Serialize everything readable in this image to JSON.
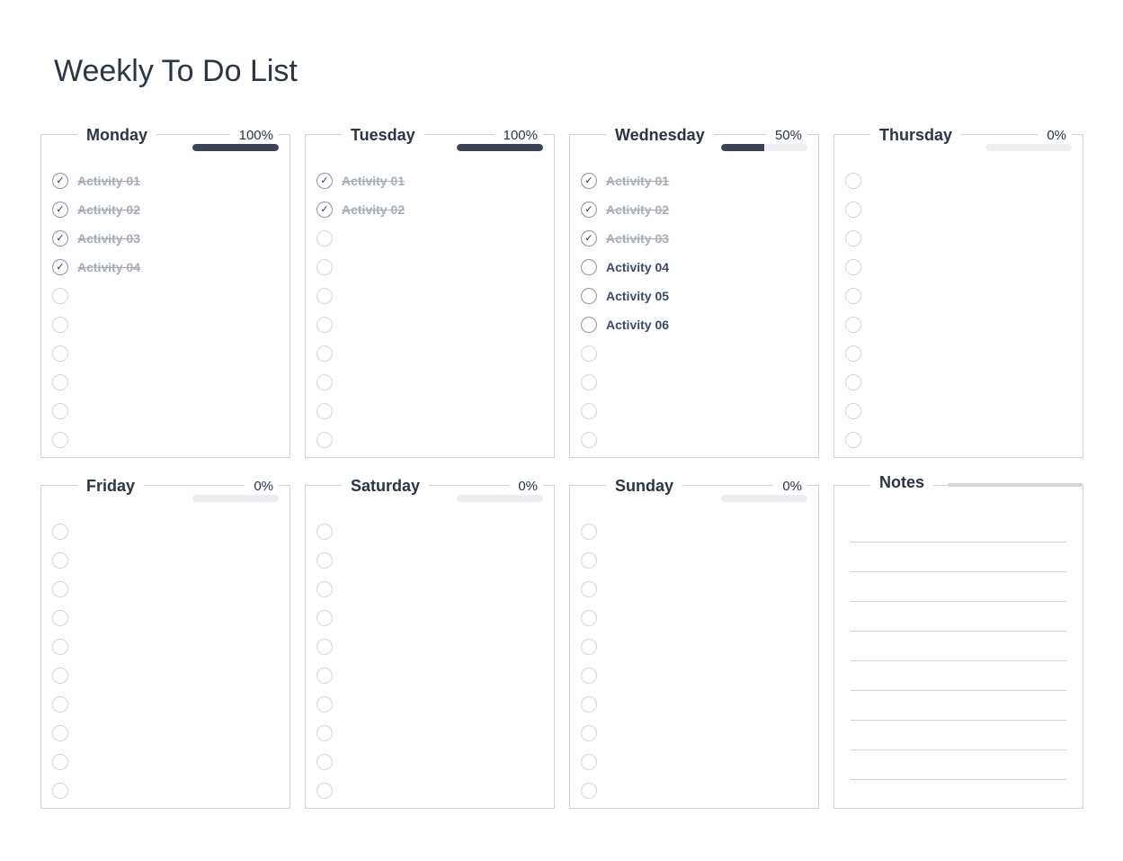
{
  "title": "Weekly To Do List",
  "notes_label": "Notes",
  "note_line_count": 9,
  "empty_rows_per_card": 10,
  "days": [
    {
      "name": "Monday",
      "percent": "100%",
      "progress": 100,
      "items": [
        {
          "label": "Activity 01",
          "done": true
        },
        {
          "label": "Activity 02",
          "done": true
        },
        {
          "label": "Activity 03",
          "done": true
        },
        {
          "label": "Activity 04",
          "done": true
        }
      ]
    },
    {
      "name": "Tuesday",
      "percent": "100%",
      "progress": 100,
      "items": [
        {
          "label": "Activity 01",
          "done": true
        },
        {
          "label": "Activity 02",
          "done": true
        }
      ]
    },
    {
      "name": "Wednesday",
      "percent": "50%",
      "progress": 50,
      "items": [
        {
          "label": "Activity 01",
          "done": true
        },
        {
          "label": "Activity 02",
          "done": true
        },
        {
          "label": "Activity 03",
          "done": true
        },
        {
          "label": "Activity 04",
          "done": false
        },
        {
          "label": "Activity 05",
          "done": false
        },
        {
          "label": "Activity 06",
          "done": false
        }
      ]
    },
    {
      "name": "Thursday",
      "percent": "0%",
      "progress": 0,
      "items": []
    },
    {
      "name": "Friday",
      "percent": "0%",
      "progress": 0,
      "items": []
    },
    {
      "name": "Saturday",
      "percent": "0%",
      "progress": 0,
      "items": []
    },
    {
      "name": "Sunday",
      "percent": "0%",
      "progress": 0,
      "items": []
    }
  ]
}
